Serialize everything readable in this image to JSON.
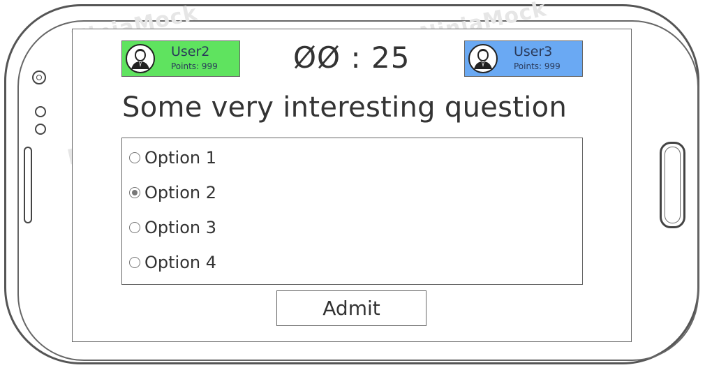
{
  "watermark": {
    "text": "NinjaMock"
  },
  "players": {
    "left": {
      "name": "User2",
      "points": "Points: 999",
      "color": "#5fe35f"
    },
    "right": {
      "name": "User3",
      "points": "Points: 999",
      "color": "#6aa9f3"
    }
  },
  "timer": {
    "text": "ØØ : 25"
  },
  "question": {
    "text": "Some very interesting question"
  },
  "options": [
    {
      "label": "Option 1",
      "selected": false
    },
    {
      "label": "Option 2",
      "selected": true
    },
    {
      "label": "Option 3",
      "selected": false
    },
    {
      "label": "Option 4",
      "selected": false
    }
  ],
  "actions": {
    "submit_label": "Admit"
  }
}
